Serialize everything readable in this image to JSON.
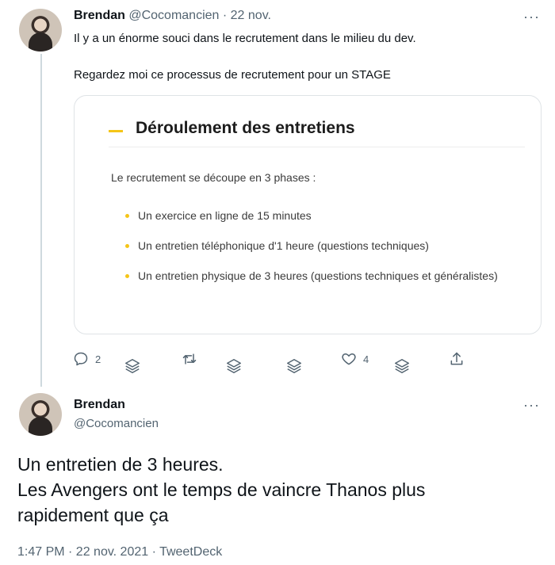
{
  "tweet1": {
    "author_name": "Brendan",
    "handle": "@Cocomancien",
    "separator": " · ",
    "date": "22 nov.",
    "more_label": "···",
    "text_line1": "Il y a un énorme souci dans le recrutement dans le milieu du dev.",
    "text_line2": "Regardez moi ce processus de recrutement pour un STAGE",
    "card": {
      "title": "Déroulement des entretiens",
      "intro": "Le recrutement se découpe en 3 phases :",
      "items": [
        "Un exercice en ligne de 15 minutes",
        "Un entretien téléphonique d'1 heure (questions techniques)",
        "Un entretien physique de 3 heures (questions techniques et généralistes)"
      ],
      "accent_color": "#f5c518"
    },
    "actions": {
      "reply_count": "2",
      "like_count": "4"
    }
  },
  "tweet2": {
    "author_name": "Brendan",
    "handle": "@Cocomancien",
    "more_label": "···",
    "text_lines": [
      "Un entretien de 3 heures.",
      "Les Avengers ont le temps de vaincre Thanos plus",
      "rapidement que ça"
    ],
    "timestamp": "1:47 PM · 22 nov. 2021 · TweetDeck"
  },
  "colors": {
    "text_primary": "#0f1419",
    "text_secondary": "#536471",
    "thread_line": "#cfd9de"
  }
}
